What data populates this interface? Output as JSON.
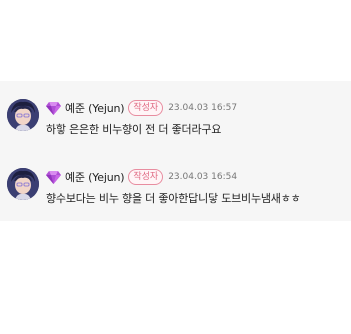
{
  "comments": [
    {
      "author": "예준 (Yejun)",
      "badge": "작성자",
      "date": "23.04.03 16:57",
      "text": "하핳 은은한 비누향이 전 더 좋더라구요",
      "icon": "purple-gem-icon"
    },
    {
      "author": "예준 (Yejun)",
      "badge": "작성자",
      "date": "23.04.03 16:54",
      "text": "향수보다는 비누 향을 더 좋아한답니닿 도브비누냄새ㅎㅎ",
      "icon": "purple-gem-icon"
    }
  ],
  "colors": {
    "background": "#f6f6f6",
    "badge_text": "#e06a83",
    "gem": "#b04fd6"
  }
}
